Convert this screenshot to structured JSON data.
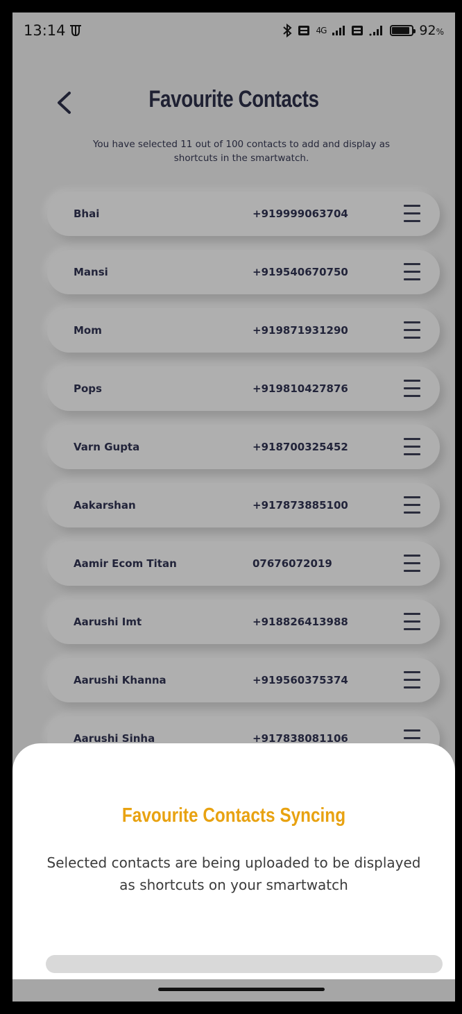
{
  "status_bar": {
    "time": "13:14",
    "network": "4G",
    "battery_percent": "92",
    "battery_suffix": "%"
  },
  "header": {
    "title": "Favourite Contacts",
    "subtitle": "You have selected 11 out of 100 contacts to add and display as shortcuts in the smartwatch."
  },
  "contacts": [
    {
      "name": "Bhai",
      "phone": "+919999063704"
    },
    {
      "name": "Mansi",
      "phone": "+919540670750"
    },
    {
      "name": "Mom",
      "phone": "+919871931290"
    },
    {
      "name": "Pops",
      "phone": "+919810427876"
    },
    {
      "name": "Varn Gupta",
      "phone": "+918700325452"
    },
    {
      "name": "Aakarshan",
      "phone": "+917873885100"
    },
    {
      "name": "Aamir Ecom Titan",
      "phone": "07676072019"
    },
    {
      "name": "Aarushi Imt",
      "phone": "+918826413988"
    },
    {
      "name": "Aarushi Khanna",
      "phone": "+919560375374"
    },
    {
      "name": "Aarushi Sinha",
      "phone": "+917838081106"
    }
  ],
  "sync_sheet": {
    "title": "Favourite Contacts Syncing",
    "message": "Selected contacts are being uploaded to be displayed as shortcuts on your smartwatch",
    "progress": 0
  },
  "colors": {
    "accent": "#e8a211",
    "background": "#a6a6a6",
    "text_dark": "#1f2133"
  }
}
